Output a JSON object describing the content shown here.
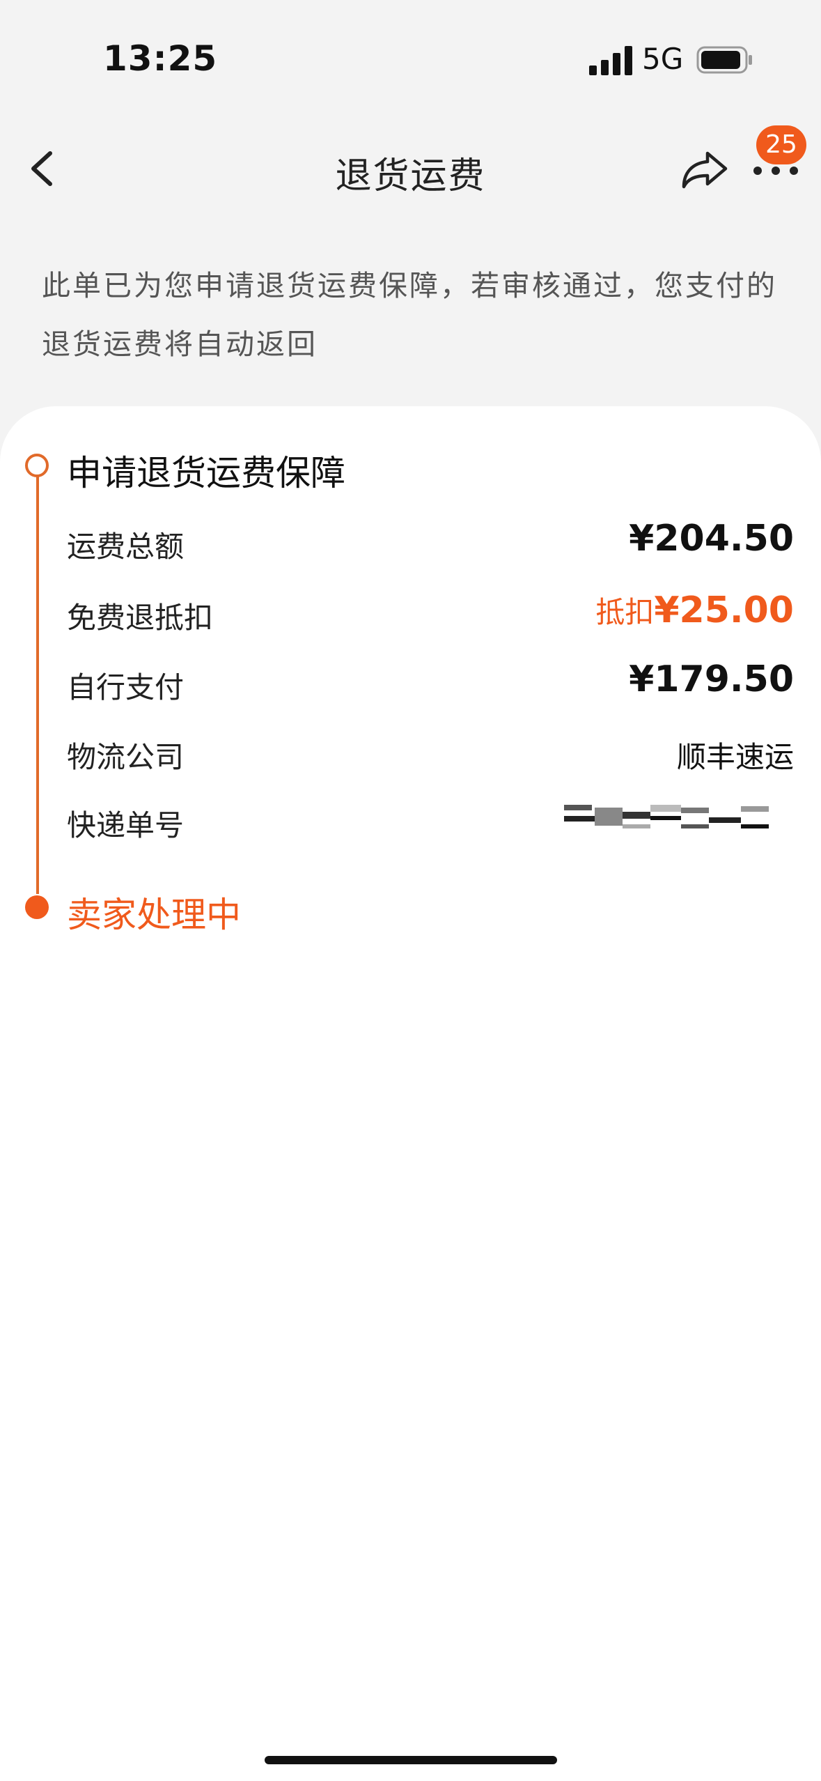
{
  "status_bar": {
    "time": "13:25",
    "network": "5G"
  },
  "nav": {
    "title": "退货运费",
    "badge_count": "25"
  },
  "notice": {
    "text": "此单已为您申请退货运费保障，若审核通过，您支付的退货运费将自动返回"
  },
  "timeline": {
    "step1_title": "申请退货运费保障",
    "step2_title": "卖家处理中"
  },
  "details": {
    "total_label": "运费总额",
    "total_value": "¥204.50",
    "free_return_label": "免费退抵扣",
    "free_return_prefix": "抵扣",
    "free_return_value": "¥25.00",
    "self_pay_label": "自行支付",
    "self_pay_value": "¥179.50",
    "carrier_label": "物流公司",
    "carrier_value": "顺丰速运",
    "tracking_label": "快递单号"
  },
  "colors": {
    "accent": "#f05a1c",
    "timeline": "#e16a2a"
  }
}
